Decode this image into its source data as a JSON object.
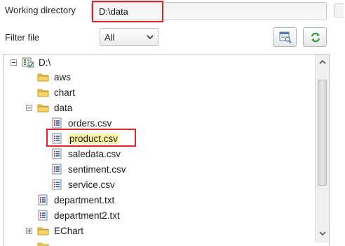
{
  "working_directory": {
    "label": "Working directory",
    "value": "D:\\data"
  },
  "filter": {
    "label": "Filter file",
    "selected": "All"
  },
  "toolbar": {
    "browse_icon": "browse-folder-icon",
    "refresh_icon": "refresh-icon"
  },
  "tree": {
    "root": "D:\\",
    "items": [
      {
        "label": "aws",
        "type": "folder"
      },
      {
        "label": "chart",
        "type": "folder"
      },
      {
        "label": "data",
        "type": "folder",
        "expanded": true
      },
      {
        "label": "orders.csv",
        "type": "file"
      },
      {
        "label": "product.csv",
        "type": "file",
        "selected": true
      },
      {
        "label": "saledata.csv",
        "type": "file"
      },
      {
        "label": "sentiment.csv",
        "type": "file"
      },
      {
        "label": "service.csv",
        "type": "file"
      },
      {
        "label": "department.txt",
        "type": "file"
      },
      {
        "label": "department2.txt",
        "type": "file"
      },
      {
        "label": "EChart",
        "type": "folder",
        "expanded": false
      }
    ]
  },
  "colors": {
    "highlight": "#e0252b",
    "folder": "#f2c64a",
    "selection": "#fdf3a8",
    "refresh": "#2e9e3a"
  }
}
